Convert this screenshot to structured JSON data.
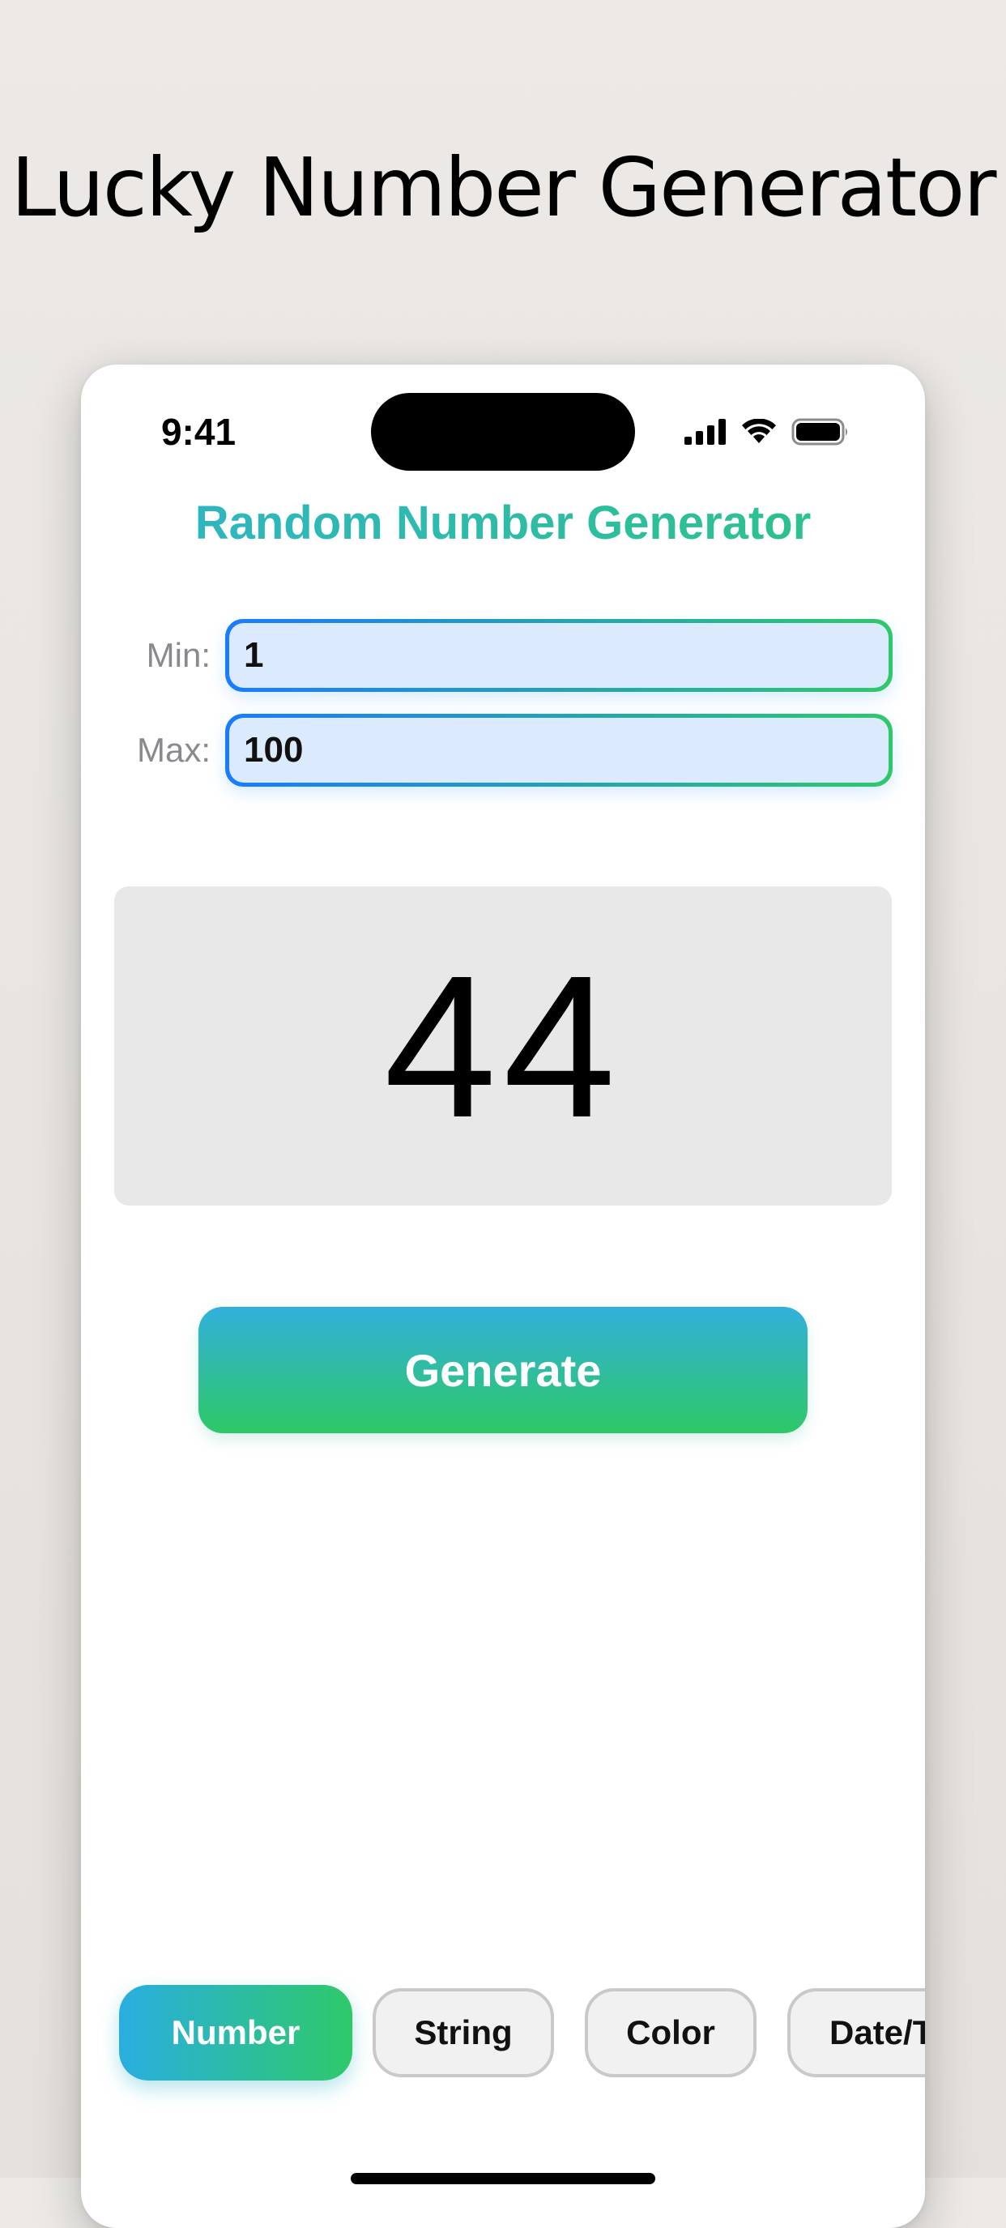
{
  "headline": "Lucky Number Generator",
  "status_bar": {
    "time": "9:41",
    "icons": [
      "cellular-signal-icon",
      "wifi-icon",
      "battery-icon"
    ]
  },
  "app": {
    "title": "Random Number Generator",
    "min": {
      "label": "Min:",
      "value": "1"
    },
    "max": {
      "label": "Max:",
      "value": "100"
    },
    "result": "44",
    "generate_label": "Generate"
  },
  "tabs": [
    {
      "label": "Number",
      "selected": true
    },
    {
      "label": "String",
      "selected": false
    },
    {
      "label": "Color",
      "selected": false
    },
    {
      "label": "Date/T",
      "selected": false
    }
  ],
  "colors": {
    "accent_blue": "#2aaee0",
    "accent_green": "#2ec96a",
    "title_teal": "#2ab9a6",
    "field_fill": "#dbeafc",
    "result_bg": "#e8e8e8"
  }
}
